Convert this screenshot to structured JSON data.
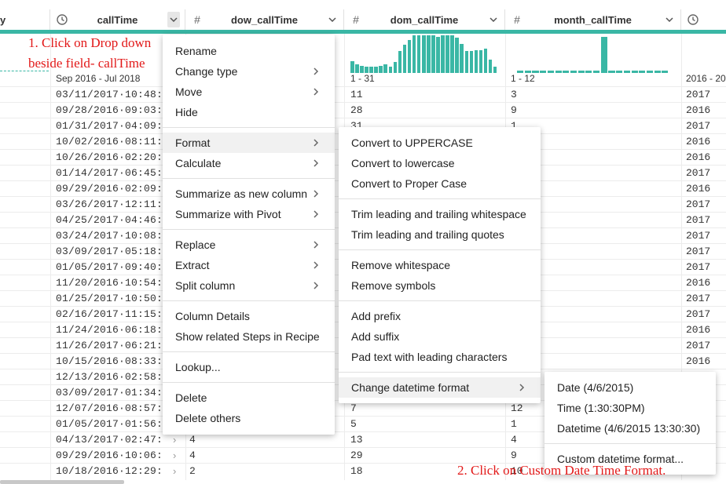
{
  "columns": [
    {
      "name": "y",
      "icon": "none"
    },
    {
      "name": "callTime",
      "icon": "clock-icon"
    },
    {
      "name": "dow_callTime",
      "icon": "hash-icon"
    },
    {
      "name": "dom_callTime",
      "icon": "hash-icon"
    },
    {
      "name": "month_callTime",
      "icon": "hash-icon"
    },
    {
      "name": "",
      "icon": "clock-icon"
    }
  ],
  "ranges": {
    "callTime": "Sep 2016 - Jul 2018",
    "dom_callTime": "1 - 31",
    "month_callTime": "1 - 12",
    "year": "2016 - 20"
  },
  "dom_histogram": [
    1,
    0.7,
    0.6,
    0.5,
    0.5,
    0.5,
    0.6,
    0.7,
    0.5,
    0.9,
    1.8,
    2.3,
    2.7,
    3.1,
    3.1,
    3.1,
    3.1,
    3.1,
    3.0,
    3.1,
    3.1,
    3.1,
    2.9,
    2.4,
    1.8,
    1.8,
    1.9,
    1.9,
    2.0,
    1.1,
    0.5
  ],
  "month_histogram": [
    0.3,
    0.3,
    0.3,
    0.3,
    0.3,
    0.3,
    0.3,
    0.3,
    0.3,
    0.3,
    0.3,
    4.5,
    0.3,
    0.3,
    0.3,
    0.3,
    0.3,
    0.3,
    0.3,
    0.3
  ],
  "rows": [
    {
      "callTime": "03/11/2017·10:48:02",
      "dow": "",
      "dom": "11",
      "month": "3",
      "year": "2017"
    },
    {
      "callTime": "09/28/2016·09:03:06",
      "dow": "",
      "dom": "28",
      "month": "9",
      "year": "2016"
    },
    {
      "callTime": "01/31/2017·04:09:19",
      "dow": "",
      "dom": "31",
      "month": "1",
      "year": "2017"
    },
    {
      "callTime": "10/02/2016·08:11:38",
      "dow": "",
      "dom": "",
      "month": "",
      "year": "2016"
    },
    {
      "callTime": "10/26/2016·02:20:20",
      "dow": "",
      "dom": "",
      "month": "",
      "year": "2016"
    },
    {
      "callTime": "01/14/2017·06:45:31",
      "dow": "",
      "dom": "",
      "month": "",
      "year": "2017"
    },
    {
      "callTime": "09/29/2016·02:09:03",
      "dow": "",
      "dom": "",
      "month": "",
      "year": "2016"
    },
    {
      "callTime": "03/26/2017·12:11:40",
      "dow": "",
      "dom": "",
      "month": "",
      "year": "2017"
    },
    {
      "callTime": "04/25/2017·04:46:49",
      "dow": "",
      "dom": "",
      "month": "",
      "year": "2017"
    },
    {
      "callTime": "03/24/2017·10:08:50",
      "dow": "",
      "dom": "",
      "month": "",
      "year": "2017"
    },
    {
      "callTime": "03/09/2017·05:18:23",
      "dow": "",
      "dom": "",
      "month": "",
      "year": "2017"
    },
    {
      "callTime": "01/05/2017·09:40:37",
      "dow": "",
      "dom": "",
      "month": "",
      "year": "2017"
    },
    {
      "callTime": "11/20/2016·10:54:30",
      "dow": "",
      "dom": "",
      "month": "",
      "year": "2016"
    },
    {
      "callTime": "01/25/2017·10:50:40",
      "dow": "",
      "dom": "",
      "month": "",
      "year": "2017"
    },
    {
      "callTime": "02/16/2017·11:15:05",
      "dow": "",
      "dom": "",
      "month": "",
      "year": "2017"
    },
    {
      "callTime": "11/24/2016·06:18:31",
      "dow": "",
      "dom": "",
      "month": "",
      "year": "2016"
    },
    {
      "callTime": "11/26/2017·06:21:17",
      "dow": "",
      "dom": "",
      "month": "",
      "year": "2017"
    },
    {
      "callTime": "10/15/2016·08:33:55",
      "dow": "",
      "dom": "",
      "month": "",
      "year": "2016"
    },
    {
      "callTime": "12/13/2016·02:58:18",
      "dow": "",
      "dom": "",
      "month": "",
      "year": ""
    },
    {
      "callTime": "03/09/2017·01:34:41",
      "dow": "",
      "dom": "",
      "month": "",
      "year": ""
    },
    {
      "callTime": "12/07/2016·08:57:37",
      "dow": "",
      "dom": "7",
      "month": "12",
      "year": ""
    },
    {
      "callTime": "01/05/2017·01:56:13",
      "dow": "",
      "dom": "5",
      "month": "1",
      "year": ""
    },
    {
      "callTime": "04/13/2017·02:47:38",
      "dow": "4",
      "dom": "13",
      "month": "4",
      "year": ""
    },
    {
      "callTime": "09/29/2016·10:06:51",
      "dow": "4",
      "dom": "29",
      "month": "9",
      "year": ""
    },
    {
      "callTime": "10/18/2016·12:29:37",
      "dow": "2",
      "dom": "18",
      "month": "10",
      "year": ""
    }
  ],
  "annotations": {
    "step1_line1": "1. Click on Drop down",
    "step1_line2": "beside field- callTime",
    "step2": "2. Click on Custom Date Time Format."
  },
  "column_menu": {
    "groups": [
      [
        {
          "label": "Rename",
          "sub": false
        },
        {
          "label": "Change type",
          "sub": true
        },
        {
          "label": "Move",
          "sub": true
        },
        {
          "label": "Hide",
          "sub": false
        }
      ],
      [
        {
          "label": "Format",
          "sub": true,
          "active": true
        },
        {
          "label": "Calculate",
          "sub": true
        }
      ],
      [
        {
          "label": "Summarize as new column",
          "sub": true
        },
        {
          "label": "Summarize with Pivot",
          "sub": true
        }
      ],
      [
        {
          "label": "Replace",
          "sub": true
        },
        {
          "label": "Extract",
          "sub": true
        },
        {
          "label": "Split column",
          "sub": true
        }
      ],
      [
        {
          "label": "Column Details",
          "sub": false
        },
        {
          "label": "Show related Steps in Recipe",
          "sub": false
        }
      ],
      [
        {
          "label": "Lookup...",
          "sub": false
        }
      ],
      [
        {
          "label": "Delete",
          "sub": false
        },
        {
          "label": "Delete others",
          "sub": false
        }
      ]
    ]
  },
  "format_menu": {
    "groups": [
      [
        {
          "label": "Convert to UPPERCASE",
          "sub": false
        },
        {
          "label": "Convert to lowercase",
          "sub": false
        },
        {
          "label": "Convert to Proper Case",
          "sub": false
        }
      ],
      [
        {
          "label": "Trim leading and trailing whitespace",
          "sub": false
        },
        {
          "label": "Trim leading and trailing quotes",
          "sub": false
        }
      ],
      [
        {
          "label": "Remove whitespace",
          "sub": false
        },
        {
          "label": "Remove symbols",
          "sub": false
        }
      ],
      [
        {
          "label": "Add prefix",
          "sub": false
        },
        {
          "label": "Add suffix",
          "sub": false
        },
        {
          "label": "Pad text with leading characters",
          "sub": false
        }
      ],
      [
        {
          "label": "Change datetime format",
          "sub": true,
          "active": true
        }
      ]
    ]
  },
  "datetime_menu": {
    "groups": [
      [
        {
          "label": "Date (4/6/2015)",
          "sub": false
        },
        {
          "label": "Time (1:30:30PM)",
          "sub": false
        },
        {
          "label": "Datetime (4/6/2015 13:30:30)",
          "sub": false
        }
      ],
      [
        {
          "label": "Custom datetime format...",
          "sub": false
        }
      ]
    ]
  },
  "colors": {
    "accent": "#3ab7a5",
    "annotation": "#e21818"
  }
}
